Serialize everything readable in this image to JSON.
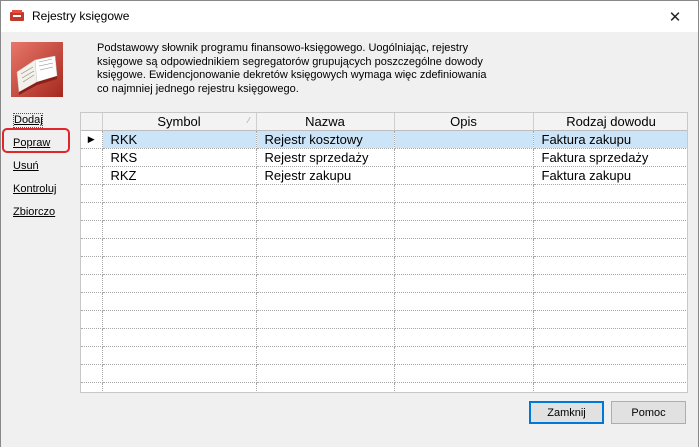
{
  "window": {
    "title": "Rejestry księgowe"
  },
  "description": "Podstawowy słownik programu finansowo-księgowego. Uogólniając, rejestry księgowe są odpowiednikiem segregatorów grupujących poszczególne dowody księgowe. Ewidencjonowanie dekretów księgowych wymaga więc zdefiniowania co najmniej jednego rejestru księgowego.",
  "description_lines": [
    "Podstawowy słownik programu finansowo-księgowego. Uogólniając, rejestry",
    "księgowe są odpowiednikiem segregatorów grupujących poszczególne dowody",
    "księgowe. Ewidencjonowanie dekretów księgowych wymaga więc zdefiniowania",
    "co najmniej jednego rejestru księgowego."
  ],
  "sidebar": {
    "items": [
      {
        "label": "Dodaj"
      },
      {
        "label": "Popraw"
      },
      {
        "label": "Usuń"
      },
      {
        "label": "Kontroluj"
      },
      {
        "label": "Zbiorczo"
      }
    ]
  },
  "table": {
    "columns": [
      "Symbol",
      "Nazwa",
      "Opis",
      "Rodzaj dowodu"
    ],
    "rows": [
      {
        "symbol": "RKK",
        "nazwa": "Rejestr kosztowy",
        "opis": "",
        "rodzaj": "Faktura zakupu",
        "selected": true
      },
      {
        "symbol": "RKS",
        "nazwa": "Rejestr sprzedaży",
        "opis": "",
        "rodzaj": "Faktura sprzedaży",
        "selected": false
      },
      {
        "symbol": "RKZ",
        "nazwa": "Rejestr zakupu",
        "opis": "",
        "rodzaj": "Faktura zakupu",
        "selected": false
      }
    ],
    "current_row_marker": "▶",
    "sort_marker": "⁄"
  },
  "buttons": {
    "close": "Zamknij",
    "help": "Pomoc"
  },
  "titlebar": {
    "close_glyph": "✕"
  },
  "colors": {
    "selected_row": "#cce4f7",
    "highlight_box": "#e0262b",
    "default_button_border": "#0078d7"
  }
}
